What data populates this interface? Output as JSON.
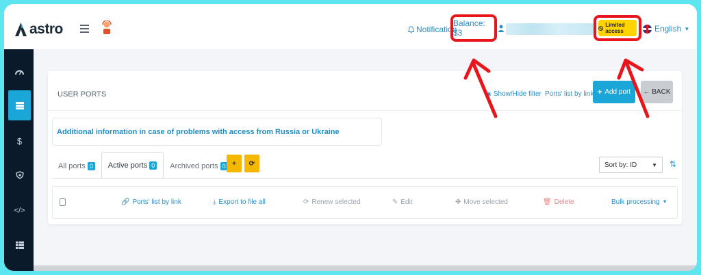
{
  "header": {
    "logo_text": "astro",
    "notifications_label": "Notification",
    "balance_label": "Balance: $3",
    "limited_access_label": "Limited access",
    "language_label": "English"
  },
  "sidebar": {
    "items": [
      {
        "icon": "dashboard-icon",
        "active": false
      },
      {
        "icon": "ports-list-icon",
        "active": true
      },
      {
        "icon": "dollar-icon",
        "active": false
      },
      {
        "icon": "shield-icon",
        "active": false
      },
      {
        "icon": "code-icon",
        "active": false
      },
      {
        "icon": "grid-icon",
        "active": false
      }
    ]
  },
  "card": {
    "title": "USER PORTS",
    "show_hide_filter": "Show/Hide filter",
    "ports_list_by_link": "Ports' list by link",
    "add_port": "Add port",
    "back": "← BACK"
  },
  "info": {
    "text": "Additional information in case of problems with access from Russia or Ukraine"
  },
  "tabs": [
    {
      "label": "All ports",
      "count": "0",
      "active": false
    },
    {
      "label": "Active ports",
      "count": "0",
      "active": true
    },
    {
      "label": "Archived ports",
      "count": "0",
      "active": false
    }
  ],
  "sort": {
    "selected": "Sort by: ID"
  },
  "bulk": {
    "ports_list_by_link": "Ports' list by link",
    "export_all": "Export to file all",
    "renew_selected": "Renew selected",
    "edit": "Edit",
    "move_selected": "Move selected",
    "delete": "Delete",
    "bulk_processing": "Bulk processing"
  },
  "colors": {
    "accent": "#1aa6d6",
    "highlight_box": "#e8161c",
    "limited_bg": "#ffd400",
    "sidebar_bg": "#0b1a2a",
    "frame_border": "#5ee6f0"
  }
}
